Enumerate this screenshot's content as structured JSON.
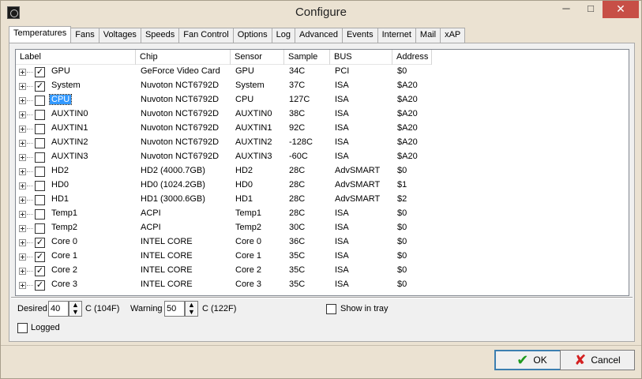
{
  "window": {
    "title": "Configure",
    "minimize_glyph": "─",
    "maximize_glyph": "□",
    "close_glyph": "✕"
  },
  "tabs": [
    {
      "label": "Temperatures",
      "active": true
    },
    {
      "label": "Fans"
    },
    {
      "label": "Voltages"
    },
    {
      "label": "Speeds"
    },
    {
      "label": "Fan Control"
    },
    {
      "label": "Options"
    },
    {
      "label": "Log"
    },
    {
      "label": "Advanced"
    },
    {
      "label": "Events"
    },
    {
      "label": "Internet"
    },
    {
      "label": "Mail"
    },
    {
      "label": "xAP"
    }
  ],
  "list": {
    "columns": [
      "Label",
      "Chip",
      "Sensor",
      "Sample",
      "BUS",
      "Address"
    ],
    "rows": [
      {
        "checked": true,
        "selected": false,
        "label": "GPU",
        "chip": "GeForce Video Card",
        "sensor": "GPU",
        "sample": "34C",
        "bus": "PCI",
        "address": "$0"
      },
      {
        "checked": true,
        "selected": false,
        "label": "System",
        "chip": "Nuvoton NCT6792D",
        "sensor": "System",
        "sample": "37C",
        "bus": "ISA",
        "address": "$A20"
      },
      {
        "checked": false,
        "selected": true,
        "label": "CPU",
        "chip": "Nuvoton NCT6792D",
        "sensor": "CPU",
        "sample": "127C",
        "bus": "ISA",
        "address": "$A20"
      },
      {
        "checked": false,
        "selected": false,
        "label": "AUXTIN0",
        "chip": "Nuvoton NCT6792D",
        "sensor": "AUXTIN0",
        "sample": "38C",
        "bus": "ISA",
        "address": "$A20"
      },
      {
        "checked": false,
        "selected": false,
        "label": "AUXTIN1",
        "chip": "Nuvoton NCT6792D",
        "sensor": "AUXTIN1",
        "sample": "92C",
        "bus": "ISA",
        "address": "$A20"
      },
      {
        "checked": false,
        "selected": false,
        "label": "AUXTIN2",
        "chip": "Nuvoton NCT6792D",
        "sensor": "AUXTIN2",
        "sample": "-128C",
        "bus": "ISA",
        "address": "$A20"
      },
      {
        "checked": false,
        "selected": false,
        "label": "AUXTIN3",
        "chip": "Nuvoton NCT6792D",
        "sensor": "AUXTIN3",
        "sample": "-60C",
        "bus": "ISA",
        "address": "$A20"
      },
      {
        "checked": false,
        "selected": false,
        "label": "HD2",
        "chip": "HD2 (4000.7GB)",
        "sensor": "HD2",
        "sample": "28C",
        "bus": "AdvSMART",
        "address": "$0"
      },
      {
        "checked": false,
        "selected": false,
        "label": "HD0",
        "chip": "HD0 (1024.2GB)",
        "sensor": "HD0",
        "sample": "28C",
        "bus": "AdvSMART",
        "address": "$1"
      },
      {
        "checked": false,
        "selected": false,
        "label": "HD1",
        "chip": "HD1 (3000.6GB)",
        "sensor": "HD1",
        "sample": "28C",
        "bus": "AdvSMART",
        "address": "$2"
      },
      {
        "checked": false,
        "selected": false,
        "label": "Temp1",
        "chip": "ACPI",
        "sensor": "Temp1",
        "sample": "28C",
        "bus": "ISA",
        "address": "$0"
      },
      {
        "checked": false,
        "selected": false,
        "label": "Temp2",
        "chip": "ACPI",
        "sensor": "Temp2",
        "sample": "30C",
        "bus": "ISA",
        "address": "$0"
      },
      {
        "checked": true,
        "selected": false,
        "label": "Core 0",
        "chip": "INTEL CORE",
        "sensor": "Core 0",
        "sample": "36C",
        "bus": "ISA",
        "address": "$0"
      },
      {
        "checked": true,
        "selected": false,
        "label": "Core 1",
        "chip": "INTEL CORE",
        "sensor": "Core 1",
        "sample": "35C",
        "bus": "ISA",
        "address": "$0"
      },
      {
        "checked": true,
        "selected": false,
        "label": "Core 2",
        "chip": "INTEL CORE",
        "sensor": "Core 2",
        "sample": "35C",
        "bus": "ISA",
        "address": "$0"
      },
      {
        "checked": true,
        "selected": false,
        "label": "Core 3",
        "chip": "INTEL CORE",
        "sensor": "Core 3",
        "sample": "35C",
        "bus": "ISA",
        "address": "$0"
      }
    ]
  },
  "controls": {
    "desired_label": "Desired",
    "desired_value": "40",
    "desired_unit": "C (104F)",
    "warning_label": "Warning",
    "warning_value": "50",
    "warning_unit": "C (122F)",
    "show_in_tray_label": "Show in tray",
    "show_in_tray_checked": false,
    "logged_label": "Logged",
    "logged_checked": false
  },
  "buttons": {
    "ok_label": "OK",
    "cancel_label": "Cancel"
  },
  "colors": {
    "selection": "#3399ff",
    "close_button": "#c74f46",
    "ok_icon": "#1f9a1f",
    "cancel_icon": "#d42020"
  }
}
